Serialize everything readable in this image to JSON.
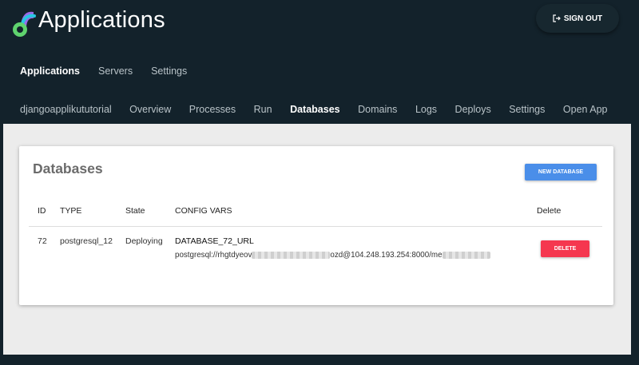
{
  "header": {
    "title": "Applications",
    "sign_out_label": "SIGN OUT",
    "logo_icon": "applikube-logo-icon",
    "sign_out_icon": "exit-icon"
  },
  "main_nav": {
    "items": [
      {
        "label": "Applications",
        "active": true
      },
      {
        "label": "Servers",
        "active": false
      },
      {
        "label": "Settings",
        "active": false
      }
    ]
  },
  "app_nav": {
    "items": [
      {
        "label": "djangoapplikututorial",
        "active": false
      },
      {
        "label": "Overview",
        "active": false
      },
      {
        "label": "Processes",
        "active": false
      },
      {
        "label": "Run",
        "active": false
      },
      {
        "label": "Databases",
        "active": true
      },
      {
        "label": "Domains",
        "active": false
      },
      {
        "label": "Logs",
        "active": false
      },
      {
        "label": "Deploys",
        "active": false
      },
      {
        "label": "Settings",
        "active": false
      },
      {
        "label": "Open App",
        "active": false
      }
    ]
  },
  "databases": {
    "title": "Databases",
    "new_button_label": "NEW DATABASE",
    "columns": [
      "ID",
      "TYPE",
      "State",
      "CONFIG VARS",
      "Delete"
    ],
    "rows": [
      {
        "id": "72",
        "type": "postgresql_12",
        "state": "Deploying",
        "config_var_name": "DATABASE_72_URL",
        "config_var_value_start": "postgresql://rhgtdyeov",
        "config_var_value_mid": "ozd@104.248.193.254:8000/me",
        "delete_label": "DELETE"
      }
    ]
  },
  "colors": {
    "background": "#13222b",
    "content_bg": "#ececec",
    "primary_button": "#4a8ee9",
    "delete_button": "#f5374f"
  }
}
